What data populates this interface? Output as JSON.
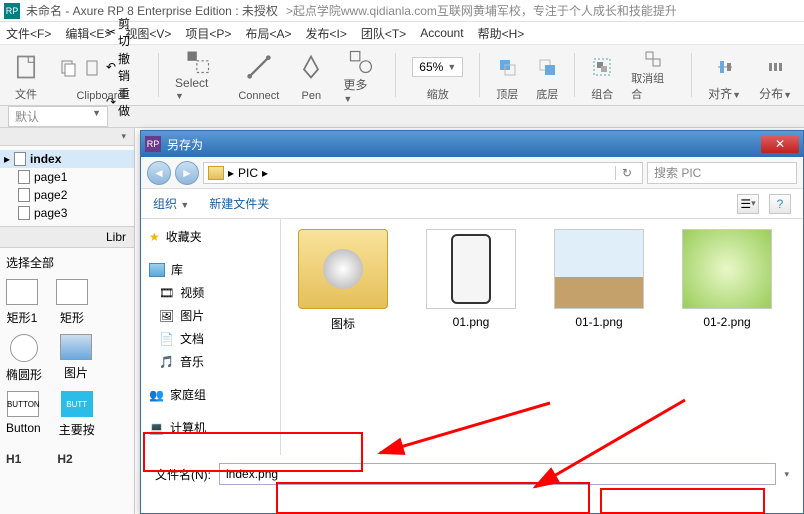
{
  "titlebar": {
    "app_icon": "RP",
    "title": "未命名 - Axure RP 8 Enterprise Edition : 未授权",
    "subtitle": ">起点学院www.qidianla.com互联网黄埔军校，专注于个人成长和技能提升"
  },
  "menu": {
    "file": "文件<F>",
    "edit": "编辑<E>",
    "view": "视图<V>",
    "project": "项目<P>",
    "arrange": "布局<A>",
    "publish": "发布<I>",
    "team": "团队<T>",
    "account": "Account",
    "help": "帮助<H>"
  },
  "toolbar": {
    "file": "文件",
    "clipboard": "Clipboard",
    "cut": "剪切",
    "copy": "撤销",
    "paste": "重做",
    "select": "Select",
    "connect": "Connect",
    "pen": "Pen",
    "more": "更多",
    "zoom": "65%",
    "zoom_label": "缩放",
    "top": "顶层",
    "bottom": "底层",
    "group": "组合",
    "ungroup": "取消组合",
    "align": "对齐",
    "distribute": "分布"
  },
  "secondary": {
    "default": "默认"
  },
  "pages": {
    "root": "index",
    "items": [
      "page1",
      "page2",
      "page3"
    ]
  },
  "library": {
    "header": "Libr",
    "select_all": "选择全部",
    "shapes": {
      "rect1": "矩形1",
      "rect": "矩形",
      "ellipse": "椭圆形",
      "img": "图片",
      "button": "Button",
      "button_label": "BUTTON",
      "main_btn": "主要按",
      "h1": "H1",
      "h2": "H2"
    }
  },
  "dialog": {
    "title": "另存为",
    "path_label": "PIC",
    "search_placeholder": "搜索 PIC",
    "organize": "组织",
    "new_folder": "新建文件夹",
    "side": {
      "favorites": "收藏夹",
      "libraries": "库",
      "videos": "视频",
      "pictures": "图片",
      "documents": "文档",
      "music": "音乐",
      "homegroup": "家庭组",
      "computer": "计算机"
    },
    "files": {
      "f1": "图标",
      "f2": "01.png",
      "f3": "01-1.png",
      "f4": "01-2.png"
    },
    "filename_label": "文件名(N):",
    "filename_value": "index.png"
  }
}
